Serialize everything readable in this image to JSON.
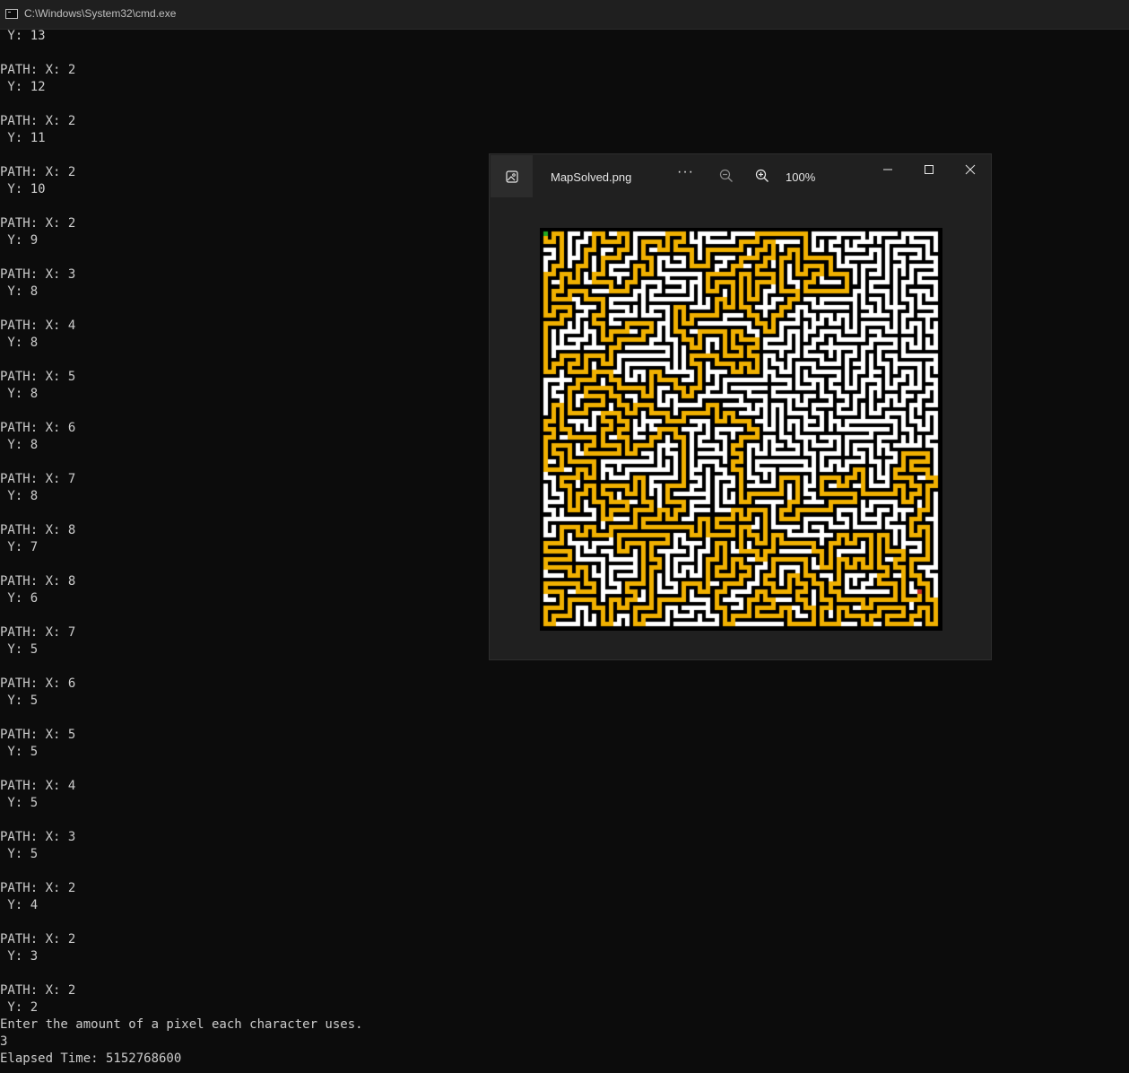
{
  "window": {
    "title": "C:\\Windows\\System32\\cmd.exe"
  },
  "console": {
    "lines": [
      " Y: 13",
      "",
      "PATH: X: 2",
      " Y: 12",
      "",
      "PATH: X: 2",
      " Y: 11",
      "",
      "PATH: X: 2",
      " Y: 10",
      "",
      "PATH: X: 2",
      " Y: 9",
      "",
      "PATH: X: 3",
      " Y: 8",
      "",
      "PATH: X: 4",
      " Y: 8",
      "",
      "PATH: X: 5",
      " Y: 8",
      "",
      "PATH: X: 6",
      " Y: 8",
      "",
      "PATH: X: 7",
      " Y: 8",
      "",
      "PATH: X: 8",
      " Y: 7",
      "",
      "PATH: X: 8",
      " Y: 6",
      "",
      "PATH: X: 7",
      " Y: 5",
      "",
      "PATH: X: 6",
      " Y: 5",
      "",
      "PATH: X: 5",
      " Y: 5",
      "",
      "PATH: X: 4",
      " Y: 5",
      "",
      "PATH: X: 3",
      " Y: 5",
      "",
      "PATH: X: 2",
      " Y: 4",
      "",
      "PATH: X: 2",
      " Y: 3",
      "",
      "PATH: X: 2",
      " Y: 2",
      "Enter the amount of a pixel each character uses.",
      "3",
      "Elapsed Time: 5152768600"
    ]
  },
  "viewer": {
    "filename": "MapSolved.png",
    "more_label": "···",
    "zoom_level": "100%",
    "icons": {
      "app": "photo-icon",
      "zoom_out": "zoom-out-icon",
      "zoom_in": "zoom-in-icon",
      "minimize": "minimize-icon",
      "maximize": "maximize-icon",
      "close": "close-icon"
    }
  },
  "colors": {
    "console_bg": "#0c0c0c",
    "console_text": "#cccccc",
    "maze_wall": "#000000",
    "maze_path": "#ffffff",
    "solution_path": "#f0b000",
    "start_marker": "#22aa22",
    "end_marker": "#d03020"
  }
}
